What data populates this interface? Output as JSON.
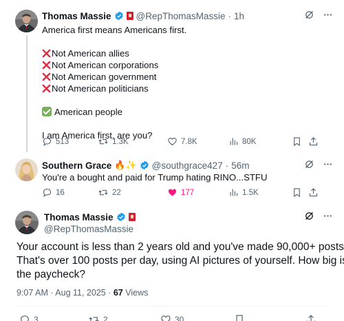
{
  "tweet1": {
    "name": "Thomas Massie",
    "handle": "@RepThomasMassie",
    "dot": "·",
    "time": "1h",
    "lines": [
      "America first means Americans first.",
      "Not American allies",
      "Not American corporations",
      "Not American government",
      "Not American politicians",
      "American people",
      "I am America first, are you?"
    ],
    "stats": {
      "replies": "513",
      "reposts": "1.3K",
      "likes": "7.8K",
      "views": "80K"
    }
  },
  "tweet2": {
    "name": "Southern Grace",
    "emojis": "🔥✨",
    "handle": "@southgrace427",
    "dot": "·",
    "time": "56m",
    "text": "You're a bought and paid for Trump hating RINO...STFU",
    "stats": {
      "replies": "16",
      "reposts": "22",
      "likes": "177",
      "views": "1.5K"
    }
  },
  "tweet3": {
    "name": "Thomas Massie",
    "handle": "@RepThomasMassie",
    "text_lines": [
      "Your account is less than 2 years old and you've made 90,000+ posts.",
      "That's over 100 posts per day, using AI pictures of yourself. How big is",
      "the paycheck?"
    ],
    "timestamp": "9:07 AM · Aug 11, 2025 · ",
    "views_count": "67",
    "views_label": "Views",
    "stats": {
      "replies": "3",
      "reposts": "2",
      "likes": "30"
    }
  },
  "icons": {
    "more": "more-icon",
    "grok": "grok-icon",
    "reply": "reply-icon",
    "repost": "repost-icon",
    "like": "like-icon",
    "views": "views-icon",
    "bookmark": "bookmark-icon",
    "share": "share-icon"
  },
  "colors": {
    "muted": "#536471",
    "verified": "#1d9bf0",
    "like_active": "#f91880",
    "text": "#0f1419"
  }
}
